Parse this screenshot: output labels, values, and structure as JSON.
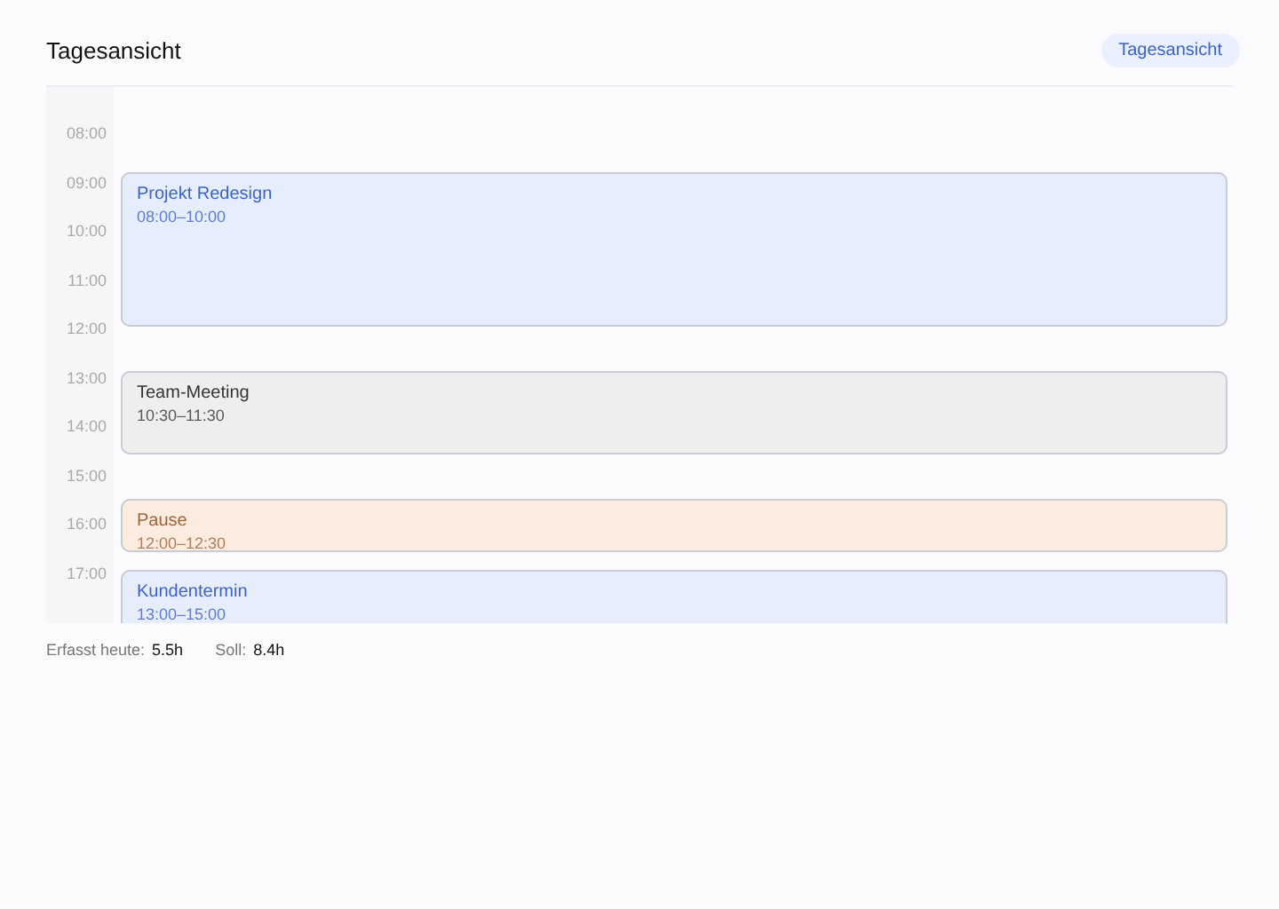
{
  "header": {
    "title": "Tagesansicht",
    "view_button": "Tagesansicht"
  },
  "timeline": {
    "hours": [
      "08:00",
      "09:00",
      "10:00",
      "11:00",
      "12:00",
      "13:00",
      "14:00",
      "15:00",
      "16:00",
      "17:00"
    ],
    "events": [
      {
        "title": "Projekt Redesign",
        "time": "08:00–10:00",
        "color": "#e6edfd"
      },
      {
        "title": "Team-Meeting",
        "time": "10:30–11:30",
        "color": "#eeeeee"
      },
      {
        "title": "Pause",
        "time": "12:00–12:30",
        "color": "#fcebdf"
      },
      {
        "title": "Kundentermin",
        "time": "13:00–15:00",
        "color": "#e8edfc"
      }
    ]
  },
  "footer": [
    {
      "label": "Erfasst heute:",
      "value": "5.5h"
    },
    {
      "label": "Soll:",
      "value": "8.4h"
    }
  ]
}
